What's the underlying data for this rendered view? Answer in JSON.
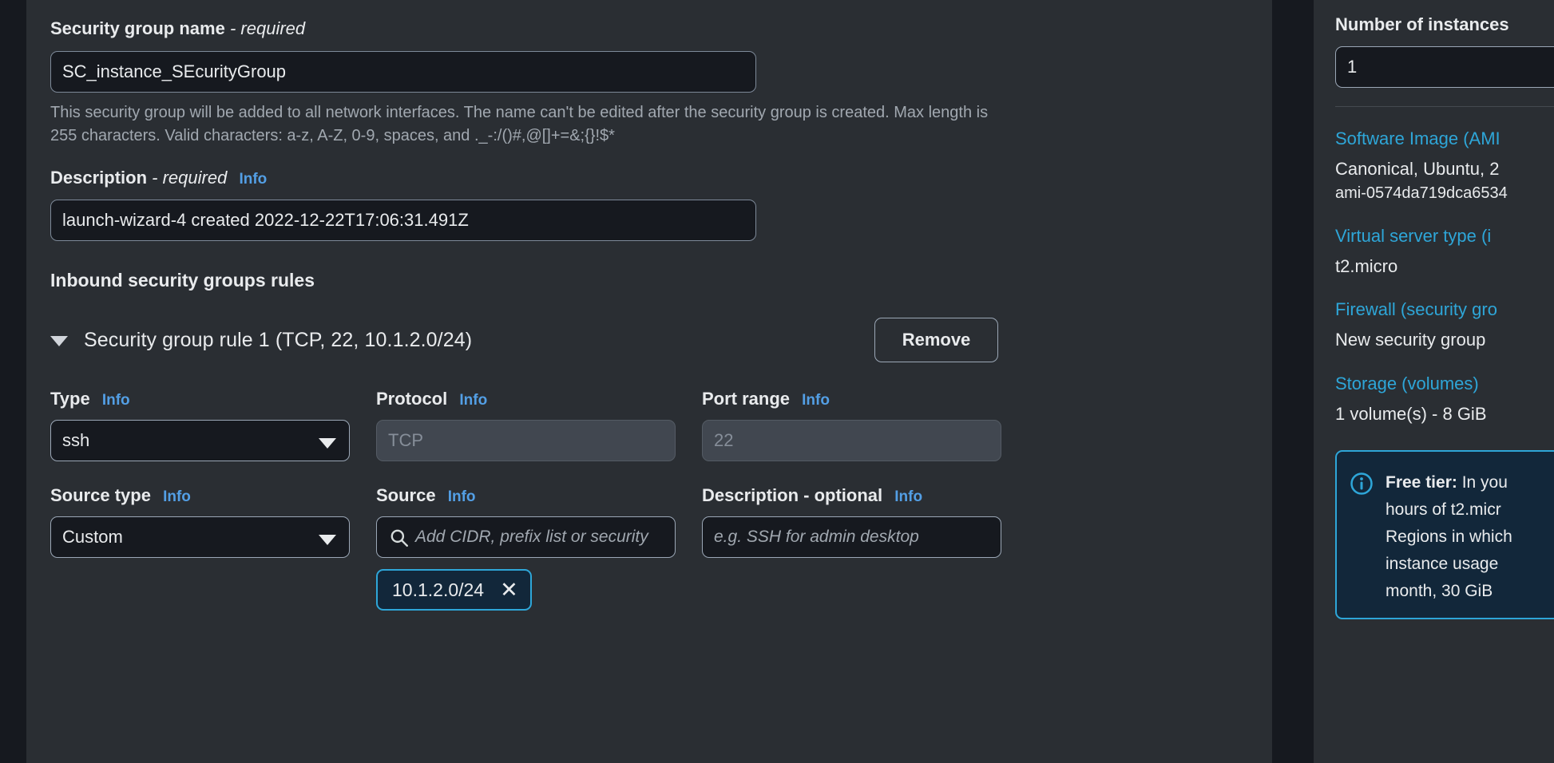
{
  "security_group": {
    "name_label": "Security group name",
    "name_required_suffix": "- required",
    "name_value": "SC_instance_SEcurityGroup",
    "name_help": "This security group will be added to all network interfaces. The name can't be edited after the security group is created. Max length is 255 characters. Valid characters: a-z, A-Z, 0-9, spaces, and ._-:/()#,@[]+=&;{}!$*",
    "description_label": "Description",
    "description_required_suffix": "- required",
    "description_info": "Info",
    "description_value": "launch-wizard-4 created 2022-12-22T17:06:31.491Z"
  },
  "inbound": {
    "section_title": "Inbound security groups rules",
    "rule": {
      "title": "Security group rule 1 (TCP, 22, 10.1.2.0/24)",
      "remove_label": "Remove",
      "type_label": "Type",
      "type_info": "Info",
      "type_value": "ssh",
      "protocol_label": "Protocol",
      "protocol_info": "Info",
      "protocol_value": "TCP",
      "port_range_label": "Port range",
      "port_range_info": "Info",
      "port_range_value": "22",
      "source_type_label": "Source type",
      "source_type_info": "Info",
      "source_type_value": "Custom",
      "source_label": "Source",
      "source_info": "Info",
      "source_placeholder": "Add CIDR, prefix list or security",
      "source_token": "10.1.2.0/24",
      "source_token_remove": "✕",
      "rule_description_label": "Description",
      "rule_description_optional_suffix": "- optional",
      "rule_description_info": "Info",
      "rule_description_placeholder": "e.g. SSH for admin desktop"
    }
  },
  "summary": {
    "instances_label": "Number of instances",
    "instances_value": "1",
    "ami_link": "Software Image (AMI",
    "ami_name": "Canonical, Ubuntu, 2",
    "ami_id": "ami-0574da719dca6534",
    "server_type_link": "Virtual server type (i",
    "server_type_value": "t2.micro",
    "firewall_link": "Firewall (security gro",
    "firewall_value": "New security group",
    "storage_link": "Storage (volumes)",
    "storage_value": "1 volume(s) - 8 GiB",
    "free_tier_heading": "Free tier:",
    "free_tier_line1": " In you",
    "free_tier_line2": "hours of t2.micr",
    "free_tier_line3": "Regions in which",
    "free_tier_line4": "instance usage",
    "free_tier_line5": "month, 30 GiB"
  },
  "colors": {
    "page_background": "#16191f",
    "panel_background": "#2a2e33",
    "input_background": "#16191f",
    "disabled_background": "#414750",
    "link_blue": "#539fe5",
    "accent_cyan": "#2ea6d8",
    "alert_background": "#12273a",
    "text_primary": "#e9ebed",
    "text_secondary": "#a1a8b0"
  }
}
